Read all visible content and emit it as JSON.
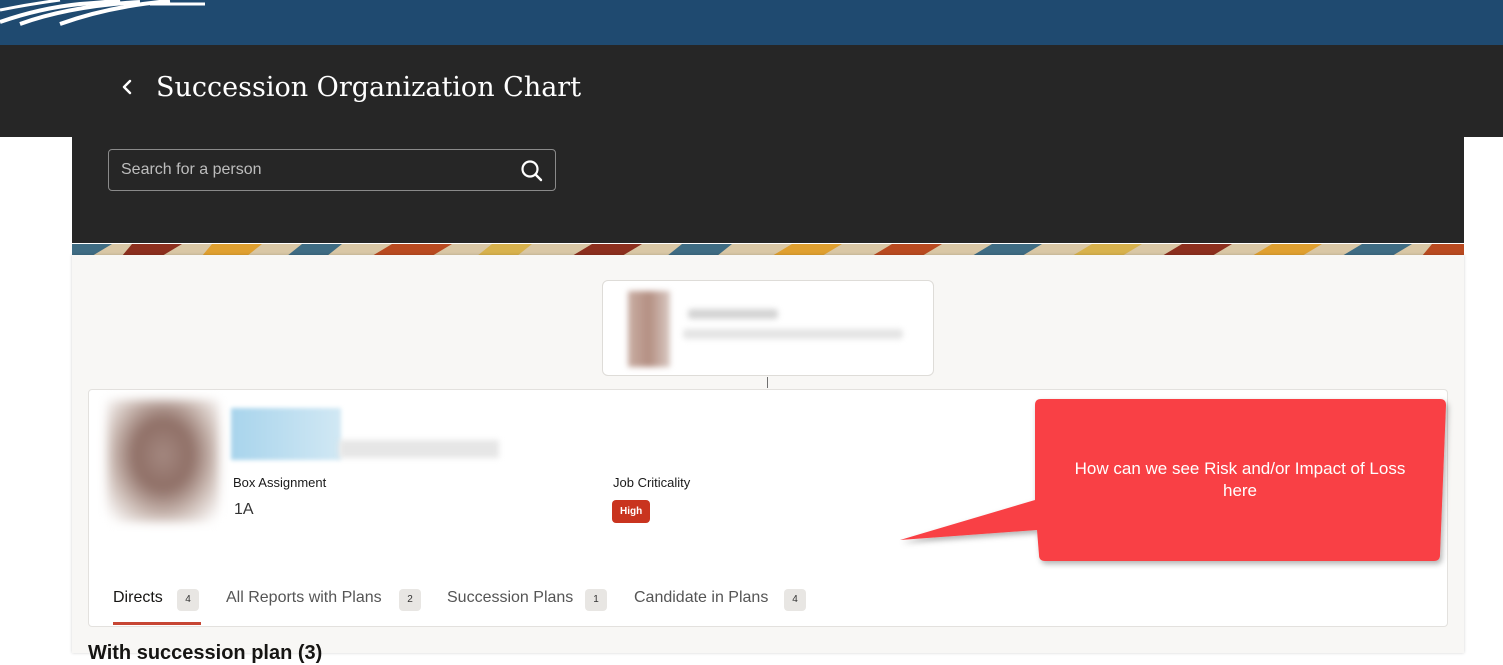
{
  "header": {
    "back_icon": "chevron-left-icon",
    "title": "Succession Organization Chart"
  },
  "search": {
    "placeholder": "Search for a person",
    "value": "",
    "icon": "search-icon"
  },
  "employee": {
    "fields": [
      {
        "label": "Box Assignment",
        "value": "1A"
      },
      {
        "label": "Job Criticality",
        "value": "High"
      }
    ]
  },
  "tabs": [
    {
      "label": "Directs",
      "count": "4",
      "active": true
    },
    {
      "label": "All Reports with Plans",
      "count": "2",
      "active": false
    },
    {
      "label": "Succession Plans",
      "count": "1",
      "active": false
    },
    {
      "label": "Candidate in Plans",
      "count": "4",
      "active": false
    }
  ],
  "section": {
    "heading": "With succession plan (3)"
  },
  "callout": {
    "text": "How can we see Risk and/or Impact of Loss here",
    "color": "#f94144"
  },
  "colors": {
    "topbar": "#1f4a70",
    "header": "#262626",
    "accent": "#c74634",
    "badge_high": "#c9341f"
  }
}
